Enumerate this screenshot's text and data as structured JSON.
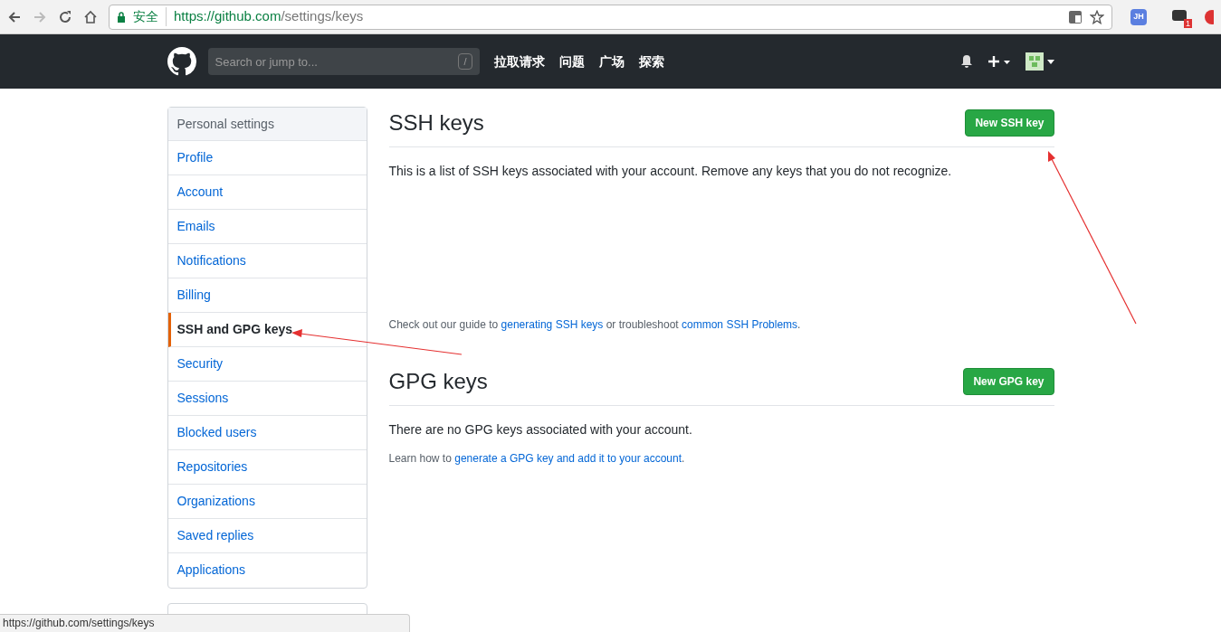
{
  "browser": {
    "secure_label": "安全",
    "url_origin": "https://github.com",
    "url_path": "/settings/keys",
    "extension_badge": "JH",
    "notification_count": "1"
  },
  "header": {
    "search": {
      "placeholder": "Search or jump to...",
      "shortcut": "/"
    },
    "nav": [
      "拉取请求",
      "问题",
      "广场",
      "探索"
    ]
  },
  "sidebar": {
    "title": "Personal settings",
    "items": [
      {
        "label": "Profile",
        "selected": false
      },
      {
        "label": "Account",
        "selected": false
      },
      {
        "label": "Emails",
        "selected": false
      },
      {
        "label": "Notifications",
        "selected": false
      },
      {
        "label": "Billing",
        "selected": false
      },
      {
        "label": "SSH and GPG keys",
        "selected": true
      },
      {
        "label": "Security",
        "selected": false
      },
      {
        "label": "Sessions",
        "selected": false
      },
      {
        "label": "Blocked users",
        "selected": false
      },
      {
        "label": "Repositories",
        "selected": false
      },
      {
        "label": "Organizations",
        "selected": false
      },
      {
        "label": "Saved replies",
        "selected": false
      },
      {
        "label": "Applications",
        "selected": false
      }
    ]
  },
  "sections": [
    {
      "title": "SSH keys",
      "button": "New SSH key",
      "description": "This is a list of SSH keys associated with your account. Remove any keys that you do not recognize.",
      "help": [
        {
          "kind": "text",
          "text": "Check out our guide to "
        },
        {
          "kind": "link",
          "text": "generating SSH keys"
        },
        {
          "kind": "text",
          "text": " or troubleshoot "
        },
        {
          "kind": "link",
          "text": "common SSH Problems"
        },
        {
          "kind": "text",
          "text": "."
        }
      ]
    },
    {
      "title": "GPG keys",
      "button": "New GPG key",
      "description": "There are no GPG keys associated with your account.",
      "help": [
        {
          "kind": "text",
          "text": "Learn how to "
        },
        {
          "kind": "link",
          "text": "generate a GPG key and add it to your account"
        },
        {
          "kind": "text",
          "text": "."
        }
      ]
    }
  ],
  "status_bar": {
    "url": "https://github.com/settings/keys"
  }
}
